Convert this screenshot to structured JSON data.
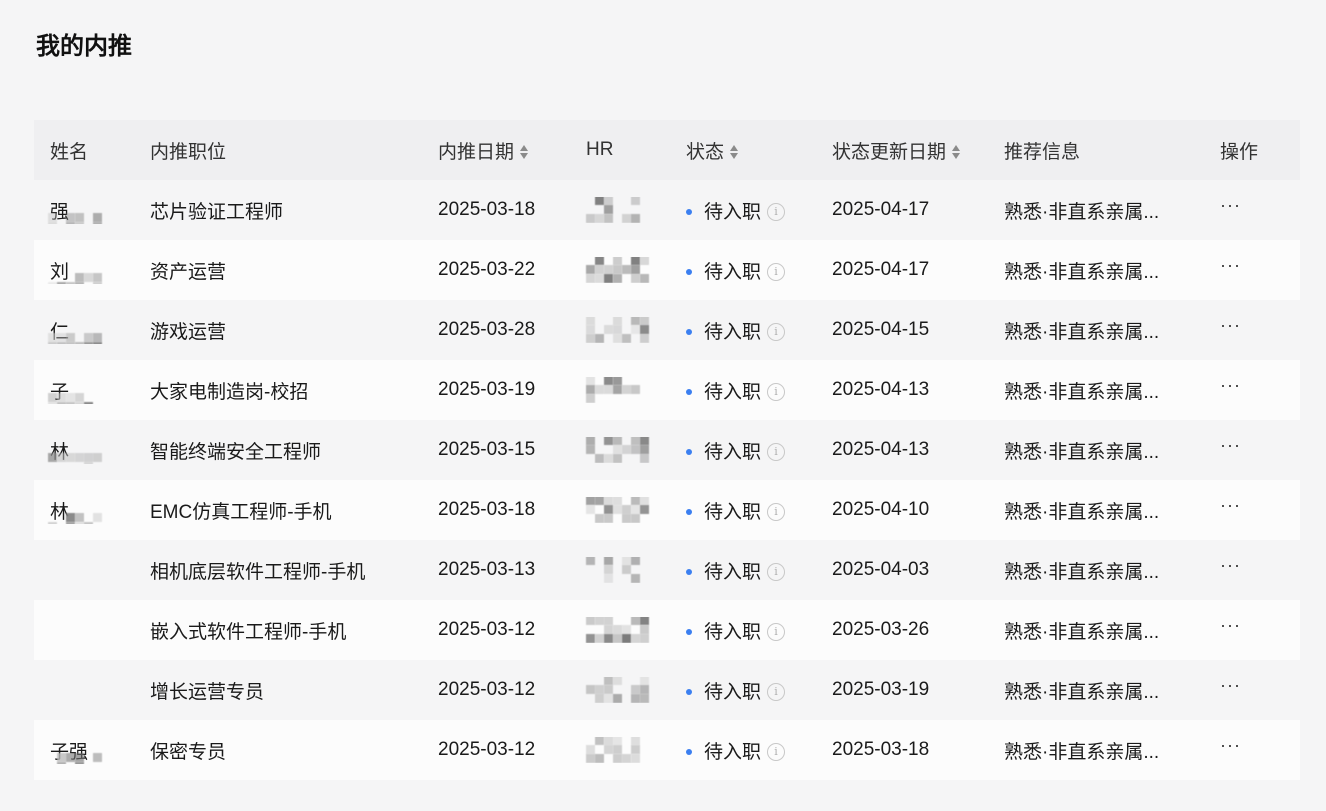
{
  "page": {
    "title": "我的内推"
  },
  "table": {
    "headers": {
      "name": "姓名",
      "position": "内推职位",
      "referral_date": "内推日期",
      "hr": "HR",
      "status": "状态",
      "status_update_date": "状态更新日期",
      "referral_info": "推荐信息",
      "actions": "操作"
    },
    "rows": [
      {
        "name": "强",
        "position": "芯片验证工程师",
        "referral_date": "2025-03-18",
        "status": "待入职",
        "status_update_date": "2025-04-17",
        "referral_info": "熟悉·非直系亲属...",
        "more": "···"
      },
      {
        "name": "刘",
        "position": "资产运营",
        "referral_date": "2025-03-22",
        "status": "待入职",
        "status_update_date": "2025-04-17",
        "referral_info": "熟悉·非直系亲属...",
        "more": "···"
      },
      {
        "name": "仁",
        "position": "游戏运营",
        "referral_date": "2025-03-28",
        "status": "待入职",
        "status_update_date": "2025-04-15",
        "referral_info": "熟悉·非直系亲属...",
        "more": "···"
      },
      {
        "name": "子",
        "position": "大家电制造岗-校招",
        "referral_date": "2025-03-19",
        "status": "待入职",
        "status_update_date": "2025-04-13",
        "referral_info": "熟悉·非直系亲属...",
        "more": "···"
      },
      {
        "name": "林",
        "position": "智能终端安全工程师",
        "referral_date": "2025-03-15",
        "status": "待入职",
        "status_update_date": "2025-04-13",
        "referral_info": "熟悉·非直系亲属...",
        "more": "···"
      },
      {
        "name": "林",
        "position": "EMC仿真工程师-手机",
        "referral_date": "2025-03-18",
        "status": "待入职",
        "status_update_date": "2025-04-10",
        "referral_info": "熟悉·非直系亲属...",
        "more": "···"
      },
      {
        "name": "",
        "position": "相机底层软件工程师-手机",
        "referral_date": "2025-03-13",
        "status": "待入职",
        "status_update_date": "2025-04-03",
        "referral_info": "熟悉·非直系亲属...",
        "more": "···"
      },
      {
        "name": "",
        "position": "嵌入式软件工程师-手机",
        "referral_date": "2025-03-12",
        "status": "待入职",
        "status_update_date": "2025-03-26",
        "referral_info": "熟悉·非直系亲属...",
        "more": "···"
      },
      {
        "name": "",
        "position": "增长运营专员",
        "referral_date": "2025-03-12",
        "status": "待入职",
        "status_update_date": "2025-03-19",
        "referral_info": "熟悉·非直系亲属...",
        "more": "···"
      },
      {
        "name": "子强",
        "position": "保密专员",
        "referral_date": "2025-03-12",
        "status": "待入职",
        "status_update_date": "2025-03-18",
        "referral_info": "熟悉·非直系亲属...",
        "more": "···"
      }
    ]
  },
  "colors": {
    "status_dot": "#3b7ff0",
    "header_bg": "#efeff1",
    "page_bg": "#f5f5f6"
  },
  "icons": {
    "sort": "sort-icon",
    "info": "info-icon",
    "more": "more-icon"
  }
}
